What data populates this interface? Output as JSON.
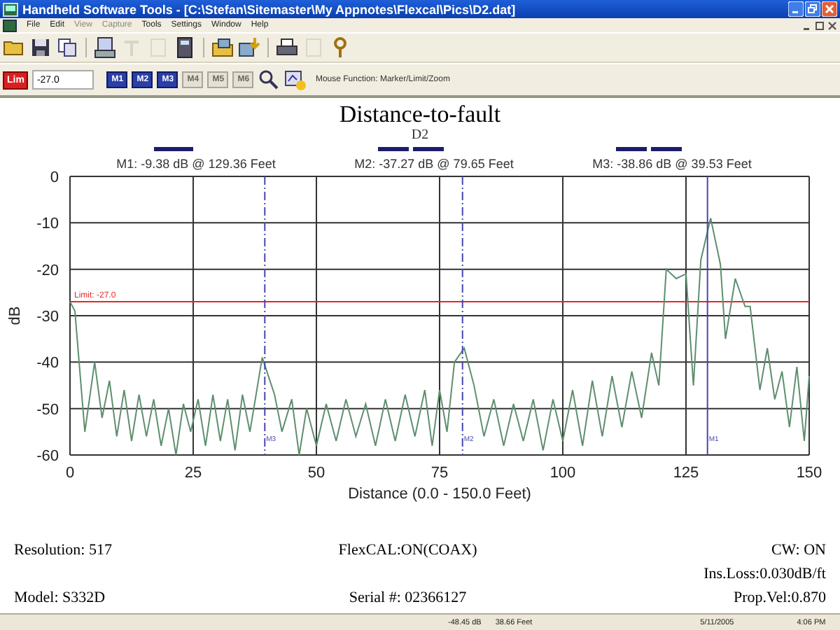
{
  "window": {
    "title": "Handheld Software Tools - [C:\\Stefan\\Sitemaster\\My Appnotes\\Flexcal\\Pics\\D2.dat]"
  },
  "menu": [
    {
      "label": "File",
      "disabled": false
    },
    {
      "label": "Edit",
      "disabled": false
    },
    {
      "label": "View",
      "disabled": true
    },
    {
      "label": "Capture",
      "disabled": true
    },
    {
      "label": "Tools",
      "disabled": false
    },
    {
      "label": "Settings",
      "disabled": false
    },
    {
      "label": "Window",
      "disabled": false
    },
    {
      "label": "Help",
      "disabled": false
    }
  ],
  "toolbar": [
    {
      "kind": "folder",
      "disabled": false
    },
    {
      "kind": "save",
      "disabled": false
    },
    {
      "kind": "copy",
      "disabled": false
    },
    {
      "kind": "sep"
    },
    {
      "kind": "instrument",
      "disabled": false
    },
    {
      "kind": "text",
      "disabled": true
    },
    {
      "kind": "page",
      "disabled": true
    },
    {
      "kind": "calculator",
      "disabled": false
    },
    {
      "kind": "sep"
    },
    {
      "kind": "folder-image",
      "disabled": false
    },
    {
      "kind": "image-arrow",
      "disabled": false
    },
    {
      "kind": "sep"
    },
    {
      "kind": "printer",
      "disabled": false
    },
    {
      "kind": "page",
      "disabled": true
    },
    {
      "kind": "help",
      "disabled": false
    }
  ],
  "limit": {
    "button": "Lim",
    "value": "-27.0"
  },
  "marker_buttons": [
    {
      "label": "M1",
      "disabled": false
    },
    {
      "label": "M2",
      "disabled": false
    },
    {
      "label": "M3",
      "disabled": false
    },
    {
      "label": "M4",
      "disabled": true
    },
    {
      "label": "M5",
      "disabled": true
    },
    {
      "label": "M6",
      "disabled": true
    }
  ],
  "mouse_function": "Mouse Function: Marker/Limit/Zoom",
  "plot": {
    "title": "Distance-to-fault",
    "subtitle": "D2",
    "chart_data": {
      "type": "line",
      "xlabel": "Distance (0.0 - 150.0 Feet)",
      "ylabel": "dB",
      "xlim": [
        0,
        150
      ],
      "ylim": [
        -60,
        0
      ],
      "xticks": [
        0,
        25,
        50,
        75,
        100,
        125,
        150
      ],
      "yticks": [
        0,
        -10,
        -20,
        -30,
        -40,
        -50,
        -60
      ],
      "x": [
        0,
        1,
        3,
        5,
        6.5,
        8,
        9.5,
        11,
        12.5,
        14,
        15.5,
        17,
        18.5,
        20,
        21.5,
        23,
        24.5,
        26,
        27.5,
        29,
        30.5,
        32,
        33.5,
        35,
        36.5,
        39,
        41.5,
        43,
        45,
        46.5,
        48,
        50,
        52,
        54,
        56,
        58,
        60,
        62,
        64,
        66,
        68,
        70,
        72,
        73.5,
        75,
        76.5,
        78,
        80,
        82,
        84,
        86,
        88,
        90,
        92,
        94,
        96,
        98,
        100,
        102,
        104,
        106,
        108,
        110,
        112,
        114,
        116,
        118,
        119.5,
        121,
        123,
        125,
        126.5,
        128,
        130,
        132,
        133,
        135,
        137,
        138,
        140,
        141.5,
        143,
        144.5,
        146,
        147.5,
        149,
        150
      ],
      "grid": true,
      "series": [
        {
          "color": "#5e8f6e",
          "values": [
            -27,
            -29,
            -55,
            -40,
            -52,
            -44,
            -56,
            -46,
            -57,
            -47,
            -56,
            -48,
            -58,
            -50,
            -60,
            -49,
            -55,
            -48,
            -58,
            -47,
            -57,
            -48,
            -59,
            -47,
            -55,
            -39,
            -47,
            -55,
            -48,
            -60,
            -50,
            -58,
            -49,
            -57,
            -48,
            -56,
            -49,
            -58,
            -48,
            -57,
            -47,
            -56,
            -46,
            -58,
            -46,
            -55,
            -40,
            -37,
            -45,
            -56,
            -48,
            -58,
            -49,
            -57,
            -48,
            -59,
            -48,
            -57,
            -46,
            -58,
            -44,
            -56,
            -43,
            -54,
            -42,
            -52,
            -38,
            -45,
            -20,
            -22,
            -21,
            -45,
            -18,
            -9,
            -19,
            -35,
            -22,
            -28,
            -28,
            -46,
            -37,
            -48,
            -42,
            -54,
            -41,
            -57,
            -43
          ]
        }
      ],
      "ref_lines": [
        {
          "axis": "y",
          "value": -27,
          "label": "Limit: -27.0",
          "color": "#e02828"
        },
        {
          "axis": "x",
          "value": 129.36,
          "label": "M1",
          "color": "#4646b0"
        },
        {
          "axis": "x",
          "value": 79.65,
          "label": "M2",
          "color": "#4646b0"
        },
        {
          "axis": "x",
          "value": 39.53,
          "label": "M3",
          "color": "#4646b0"
        }
      ]
    },
    "markers": [
      {
        "readout": "M1: -9.38 dB @ 129.36 Feet",
        "selected": true
      },
      {
        "readout": "M2: -37.27 dB @ 79.65 Feet",
        "selected": false
      },
      {
        "readout": "M3: -38.86 dB @ 39.53 Feet",
        "selected": false
      }
    ]
  },
  "footer": {
    "left": [
      "Resolution:  517",
      "Model: S332D"
    ],
    "center": [
      "FlexCAL:ON(COAX)",
      "Serial #: 02366127"
    ],
    "right": [
      "CW: ON",
      "Ins.Loss:0.030dB/ft",
      "Prop.Vel:0.870"
    ]
  },
  "status_bar": [
    "-48.45 dB",
    "38.66 Feet",
    "5/11/2005",
    "4:06 PM"
  ]
}
